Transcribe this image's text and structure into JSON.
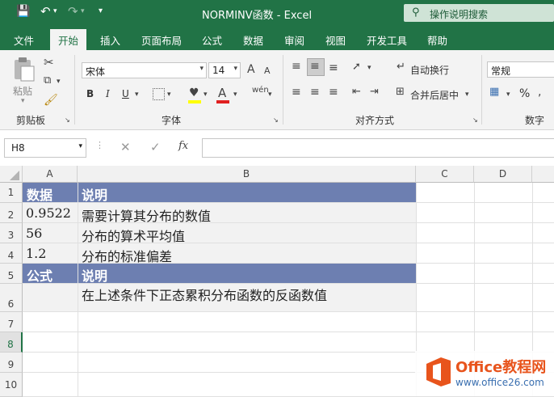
{
  "titlebar": {
    "title": "NORMINV函数  -  Excel",
    "search_placeholder": "操作说明搜索"
  },
  "tabs": [
    "文件",
    "开始",
    "插入",
    "页面布局",
    "公式",
    "数据",
    "审阅",
    "视图",
    "开发工具",
    "帮助"
  ],
  "active_tab": "开始",
  "ribbon": {
    "clipboard": {
      "paste": "粘贴",
      "label": "剪贴板"
    },
    "font": {
      "name": "宋体",
      "size": "14",
      "bold": "B",
      "italic": "I",
      "underline": "U",
      "label": "字体",
      "grow": "A",
      "shrink": "A"
    },
    "alignment": {
      "wrap": "自动换行",
      "merge": "合并后居中",
      "label": "对齐方式"
    },
    "number": {
      "format": "常规",
      "percent": "%",
      "label": "数字"
    }
  },
  "formula_bar": {
    "name_box": "H8",
    "fx": "fx",
    "value": ""
  },
  "columns": [
    "A",
    "B",
    "C",
    "D"
  ],
  "rows": [
    "1",
    "2",
    "3",
    "4",
    "5",
    "6",
    "7",
    "8",
    "9",
    "10"
  ],
  "cells": {
    "A1": "数据",
    "B1": "说明",
    "A2": "0.9522",
    "B2": "需要计算其分布的数值",
    "A3": "56",
    "B3": "分布的算术平均值",
    "A4": "1.2",
    "B4": "分布的标准偏差",
    "A5": "公式",
    "B5": "说明",
    "B6": "在上述条件下正态累积分布函数的反函数值"
  },
  "watermark": {
    "brand": "Office教程网",
    "url": "www.office26.com"
  },
  "colors": {
    "accent": "#217346",
    "header_fill": "#6d7fb1",
    "gray_fill": "#f2f2f2"
  }
}
